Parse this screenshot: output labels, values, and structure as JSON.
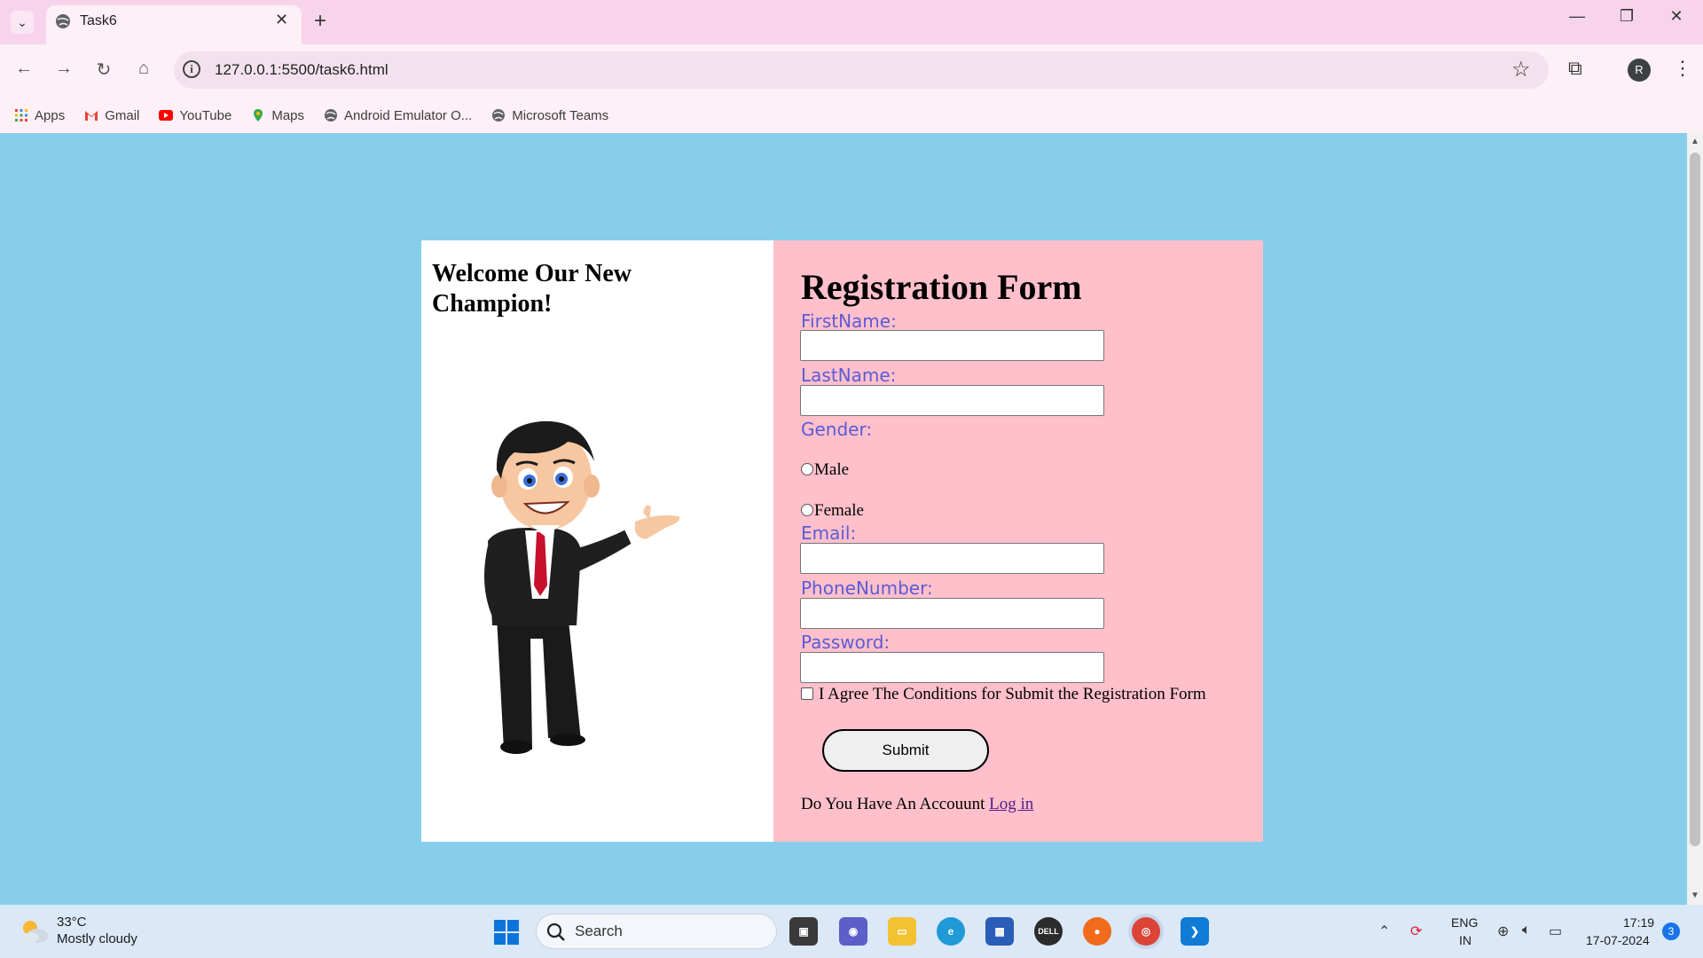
{
  "browser": {
    "tab_title": "Task6",
    "url": "127.0.0.1:5500/task6.html",
    "avatar_letter": "R",
    "bookmarks": [
      {
        "label": "Apps",
        "icon": "apps-grid-icon"
      },
      {
        "label": "Gmail",
        "icon": "gmail-icon"
      },
      {
        "label": "YouTube",
        "icon": "youtube-icon"
      },
      {
        "label": "Maps",
        "icon": "maps-pin-icon"
      },
      {
        "label": "Android Emulator O...",
        "icon": "globe-icon"
      },
      {
        "label": "Microsoft Teams",
        "icon": "globe-icon"
      }
    ]
  },
  "page": {
    "welcome": "Welcome Our New Champion!",
    "form_title": "Registration Form",
    "labels": {
      "first_name": "FirstName:",
      "last_name": "LastName:",
      "gender": "Gender:",
      "email": "Email:",
      "phone": "PhoneNumber:",
      "password": "Password:"
    },
    "gender_options": [
      "Male",
      "Female"
    ],
    "agree_text": "I Agree The Conditions for Submit the Registration Form",
    "submit_label": "Submit",
    "account_text": "Do You Have An Accouunt",
    "login_link": "Log in",
    "colors": {
      "page_bg": "#87ceeb",
      "form_bg": "#ffc0cb",
      "label_color": "#5b5bd6"
    }
  },
  "taskbar": {
    "temperature": "33°C",
    "weather": "Mostly cloudy",
    "search_placeholder": "Search",
    "lang_line1": "ENG",
    "lang_line2": "IN",
    "time": "17:19",
    "date": "17-07-2024",
    "notification_count": "3"
  }
}
